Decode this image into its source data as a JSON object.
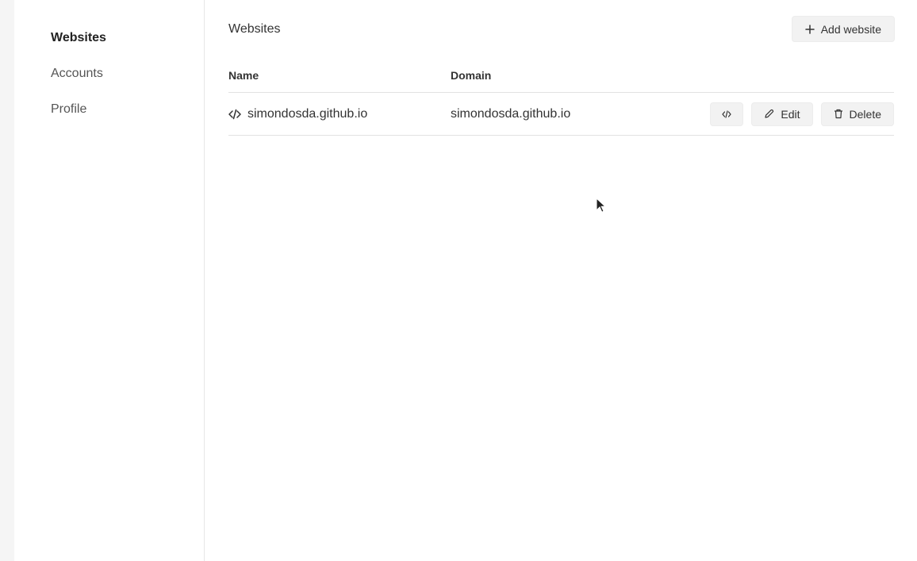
{
  "sidebar": {
    "items": [
      {
        "label": "Websites",
        "active": true
      },
      {
        "label": "Accounts",
        "active": false
      },
      {
        "label": "Profile",
        "active": false
      }
    ]
  },
  "header": {
    "title": "Websites",
    "add_button_label": "Add website",
    "add_button_icon": "plus-icon"
  },
  "table": {
    "columns": [
      "Name",
      "Domain"
    ],
    "rows": [
      {
        "name": "simondosda.github.io",
        "domain": "simondosda.github.io",
        "icon": "code-icon",
        "actions": {
          "code_icon": "code-icon",
          "edit_label": "Edit",
          "delete_label": "Delete"
        }
      }
    ]
  }
}
